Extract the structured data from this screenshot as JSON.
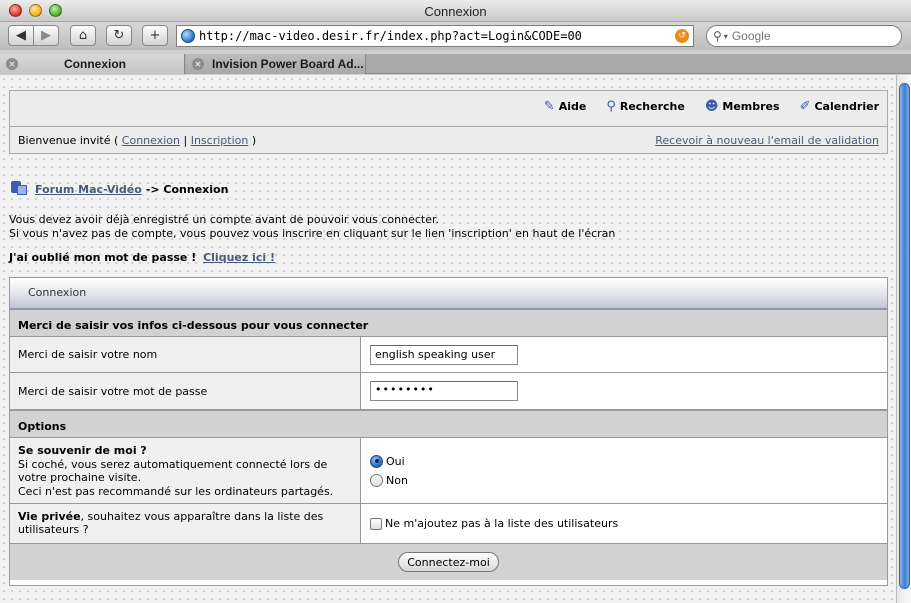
{
  "window": {
    "title": "Connexion"
  },
  "toolbar": {
    "url": "http://mac-video.desir.fr/index.php?act=Login&CODE=00",
    "search_placeholder": "Google",
    "back_icon": "◀",
    "forward_icon": "▶",
    "home_icon": "⌂",
    "reload_icon": "↻",
    "add_icon": "+"
  },
  "tabs": [
    {
      "label": "Connexion",
      "active": true
    },
    {
      "label": "Invision Power Board Ad...",
      "active": false
    }
  ],
  "nav": {
    "links": [
      {
        "label": "Aide",
        "icon": "help-icon"
      },
      {
        "label": "Recherche",
        "icon": "search-icon"
      },
      {
        "label": "Membres",
        "icon": "members-icon"
      },
      {
        "label": "Calendrier",
        "icon": "calendar-icon"
      }
    ]
  },
  "userbar": {
    "welcome": "Bienvenue invité (",
    "login_link": "Connexion",
    "separator": "|",
    "register_link": "Inscription",
    "close_paren": ")",
    "resend_link": "Recevoir à nouveau l'email de validation"
  },
  "breadcrumb": {
    "forum_link": "Forum Mac-Vidéo",
    "current": "-> Connexion"
  },
  "intro": {
    "line1": "Vous devez avoir déjà enregistré un compte avant de pouvoir vous connecter.",
    "line2": "Si vous n'avez pas de compte, vous pouvez vous inscrire en cliquant sur le lien 'inscription' en haut de l'écran"
  },
  "forgot": {
    "text": "J'ai oublié mon mot de passe !",
    "link": "Cliquez ici !"
  },
  "form": {
    "header": "Connexion",
    "section_title": "Merci de saisir vos infos ci-dessous pour vous connecter",
    "name_label": "Merci de saisir votre nom",
    "name_value": "english speaking user",
    "password_label": "Merci de saisir votre mot de passe",
    "password_value": "••••••••",
    "options_title": "Options",
    "remember_title": "Se souvenir de moi ?",
    "remember_desc1": "Si coché, vous serez automatiquement connecté lors de votre prochaine visite.",
    "remember_desc2": "Ceci n'est pas recommandé sur les ordinateurs partagés.",
    "remember_yes": "Oui",
    "remember_no": "Non",
    "remember_selected": "Oui",
    "privacy_title": "Vie privée",
    "privacy_desc": ", souhaitez vous apparaître dans la liste des utilisateurs ?",
    "privacy_option": "Ne m'ajoutez pas à la liste des utilisateurs",
    "submit": "Connectez-moi"
  }
}
